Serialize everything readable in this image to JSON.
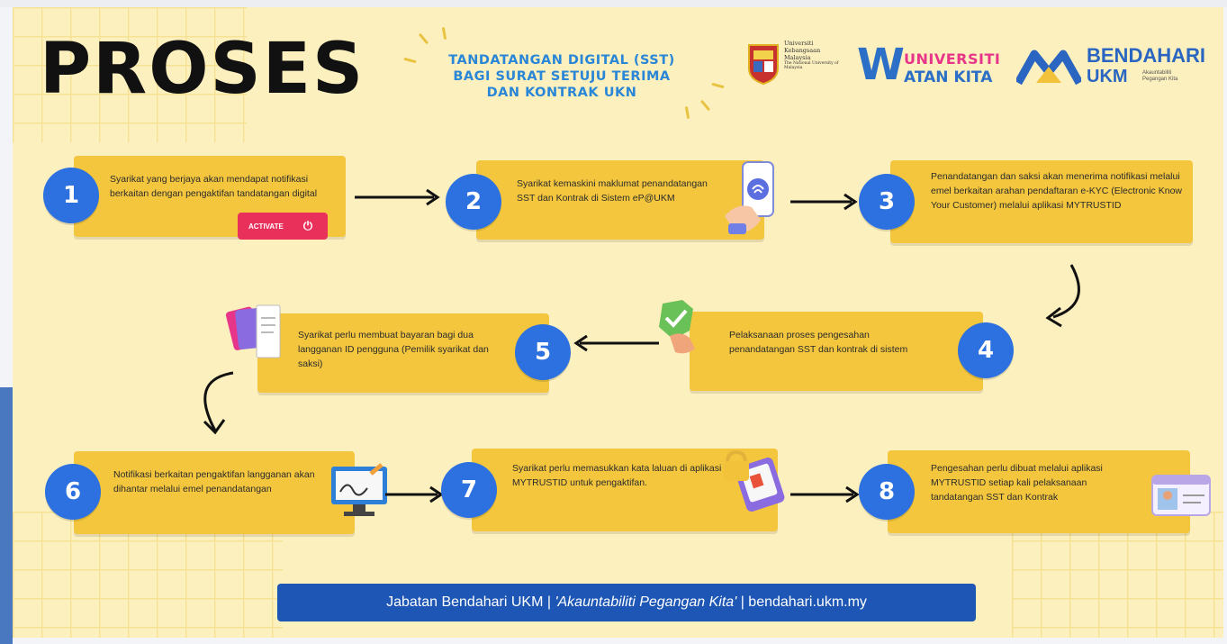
{
  "title": "PROSES",
  "subtitle_lines": [
    "TANDATANGAN DIGITAL (SST)",
    "BAGI SURAT SETUJU TERIMA",
    "DAN KONTRAK UKN"
  ],
  "logos": {
    "ukm": {
      "lines": [
        "Universiti",
        "Kebangsaan",
        "Malaysia"
      ],
      "small": "The National University of Malaysia"
    },
    "universiti_watan_kita": {
      "mark": "W",
      "line1": "UNIVERSITI",
      "line2": "ATAN KITA"
    },
    "bendahari": {
      "name": "BENDAHARI",
      "ukm": "UKM",
      "tagline": "Akauntabiliti Pegangan Kita"
    }
  },
  "steps": [
    {
      "number": "1",
      "text": "Syarikat yang berjaya akan mendapat notifikasi berkaitan dengan pengaktifan tandatangan digital",
      "button_label": "ACTIVATE",
      "button_icon": "power-icon"
    },
    {
      "number": "2",
      "text": "Syarikat kemaskini maklumat penandatangan SST dan Kontrak di Sistem eP@UKM",
      "icon": "phone-fingerprint-icon"
    },
    {
      "number": "3",
      "text": "Penandatangan dan saksi akan menerima notifikasi melalui emel berkaitan arahan pendaftaran e-KYC (Electronic Know Your Customer) melalui aplikasi MYTRUSTID"
    },
    {
      "number": "4",
      "text": "Pelaksanaan proses pengesahan penandatangan SST dan kontrak di sistem",
      "icon": "shield-check-icon"
    },
    {
      "number": "5",
      "text": "Syarikat perlu membuat bayaran bagi dua langganan ID pengguna (Pemilik syarikat dan saksi)",
      "icon": "cards-receipt-icon"
    },
    {
      "number": "6",
      "text": "Notifikasi berkaitan pengaktifan langganan akan dihantar melalui emel penandatangan",
      "icon": "monitor-signature-icon"
    },
    {
      "number": "7",
      "text": "Syarikat perlu memasukkan kata laluan di aplikasi MYTRUSTID untuk pengaktifan.",
      "icon": "lock-device-icon"
    },
    {
      "number": "8",
      "text": "Pengesahan perlu dibuat melalui aplikasi MYTRUSTID setiap kali pelaksanaan tandatangan SST dan Kontrak",
      "icon": "id-card-icon"
    }
  ],
  "footer": {
    "left": "Jabatan Bendahari UKM | ",
    "slogan": "'Akauntabiliti Pegangan Kita'",
    "right": " | bendahari.ukm.my"
  },
  "colors": {
    "background": "#fdf0bf",
    "card": "#f3c63e",
    "badge": "#2d71e0",
    "footer": "#1d56b4",
    "subtitle": "#2a86d6",
    "activate": "#e8305a"
  }
}
